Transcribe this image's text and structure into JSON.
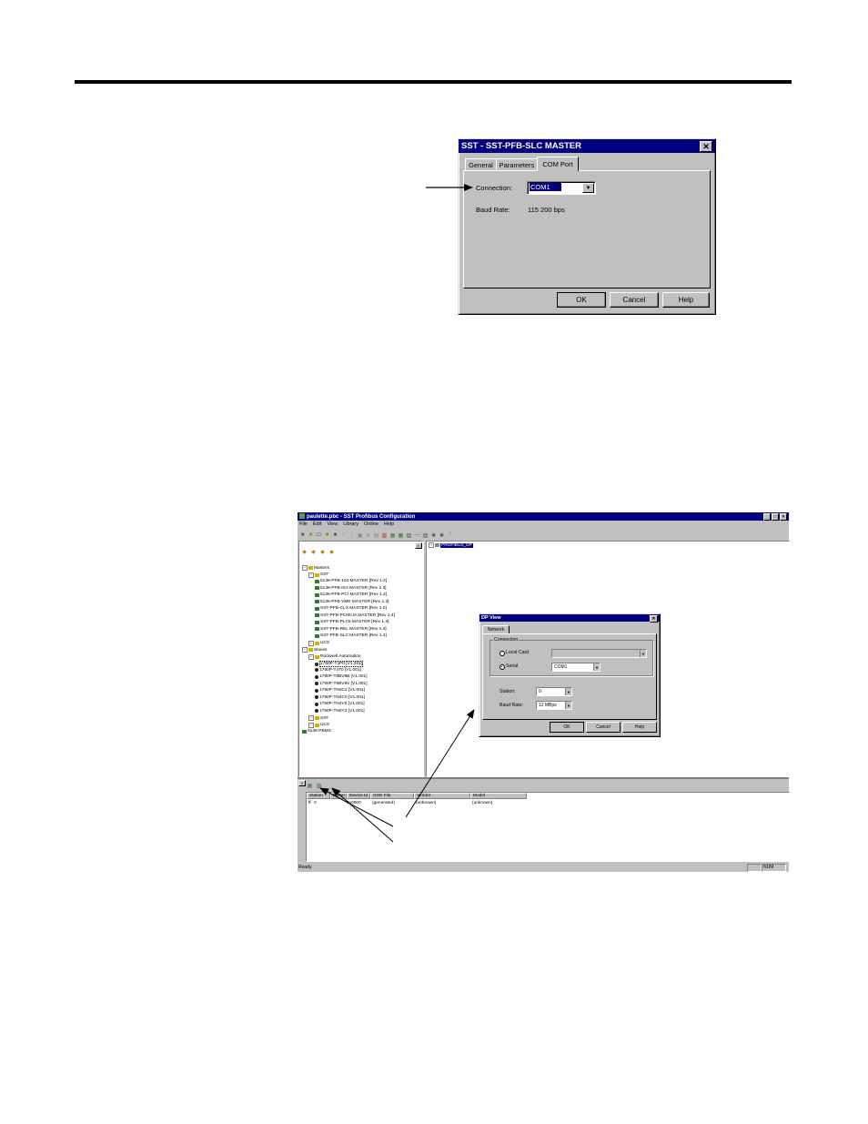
{
  "dialog1": {
    "title": "SST - SST-PFB-SLC MASTER",
    "close_glyph": "✕",
    "tabs": [
      "General",
      "Parameters",
      "COM Port"
    ],
    "active_tab": "COM Port",
    "connection_label": "Connection:",
    "connection_value": "COM1",
    "baud_label": "Baud Rate:",
    "baud_value": "115 200 bps",
    "buttons": {
      "ok": "OK",
      "cancel": "Cancel",
      "help": "Help"
    }
  },
  "app": {
    "title": "paulette.pbc - SST Profibus Configuration",
    "menu": [
      "File",
      "Edit",
      "View",
      "Library",
      "Online",
      "Help"
    ],
    "network_root": "PROFIBUS_DP",
    "tree": [
      {
        "label": "Masters",
        "level": 0,
        "type": "folder"
      },
      {
        "label": "SST",
        "level": 1,
        "type": "folder"
      },
      {
        "label": "5136-PFB-104 MASTER [Rev 1.2]",
        "level": 2,
        "type": "card"
      },
      {
        "label": "5136-PFB-ISA MASTER [Rev 1.3]",
        "level": 2,
        "type": "card"
      },
      {
        "label": "5136-PFB-PCI MASTER [Rev 1.2]",
        "level": 2,
        "type": "card"
      },
      {
        "label": "5136-PFB-VME MASTER [Rev 1.3]",
        "level": 2,
        "type": "card"
      },
      {
        "label": "SST-PFB-CLX MASTER [Rev 1.0]",
        "level": 2,
        "type": "card"
      },
      {
        "label": "SST-PFB-PCMCIA MASTER [Rev 1.4]",
        "level": 2,
        "type": "card"
      },
      {
        "label": "SST-PFB-PLC5 MASTER [Rev 1.4]",
        "level": 2,
        "type": "card"
      },
      {
        "label": "SST-PFB-REL MASTER [Rev 1.4]",
        "level": 2,
        "type": "card"
      },
      {
        "label": "SST-PFB-SLC MASTER [Rev 1.4]",
        "level": 2,
        "type": "card"
      },
      {
        "label": "UCS",
        "level": 1,
        "type": "folder"
      },
      {
        "label": "Slaves",
        "level": 0,
        "type": "folder"
      },
      {
        "label": "Rockwell Automation",
        "level": 1,
        "type": "folder"
      },
      {
        "label": "1790P-T4P0 [V1.001]",
        "level": 2,
        "type": "device"
      },
      {
        "label": "1790P-T4T0 [V1.001]",
        "level": 2,
        "type": "device"
      },
      {
        "label": "1790P-T8BV8B [V1.001]",
        "level": 2,
        "type": "device"
      },
      {
        "label": "1790P-T8BV8V [V1.001]",
        "level": 2,
        "type": "device"
      },
      {
        "label": "1790P-TN0C2 [V1.001]",
        "level": 2,
        "type": "device"
      },
      {
        "label": "1790P-TN4C0 [V1.001]",
        "level": 2,
        "type": "device"
      },
      {
        "label": "1790P-TN4V0 [V1.001]",
        "level": 2,
        "type": "device"
      },
      {
        "label": "1790P-TN0Y2 [V1.001]",
        "level": 2,
        "type": "device"
      },
      {
        "label": "SST",
        "level": 1,
        "type": "folder"
      },
      {
        "label": "UCS",
        "level": 1,
        "type": "folder"
      },
      {
        "label": "5136-PBMS",
        "level": 0,
        "type": "card"
      }
    ],
    "columns": [
      "Station",
      "Name",
      "Device Id",
      "GSD File",
      "Vendor",
      "Model"
    ],
    "row": {
      "station": "0",
      "device_id": "0x0000",
      "gsd": "(generated)",
      "vendor": "(unknown)",
      "model": "(unknown)"
    },
    "status_left": "Ready",
    "status_right": "NUM"
  },
  "dpview": {
    "title": "DP View",
    "close_glyph": "✕",
    "tab": "Network",
    "group": "Connection",
    "local_card": "Local Card",
    "serial": "Serial",
    "serial_value": "COM1",
    "station_label": "Station:",
    "station_value": "0",
    "baud_label": "Baud Rate:",
    "baud_value": "12 MBps",
    "buttons": {
      "ok": "OK",
      "cancel": "Cancel",
      "help": "Help"
    }
  }
}
